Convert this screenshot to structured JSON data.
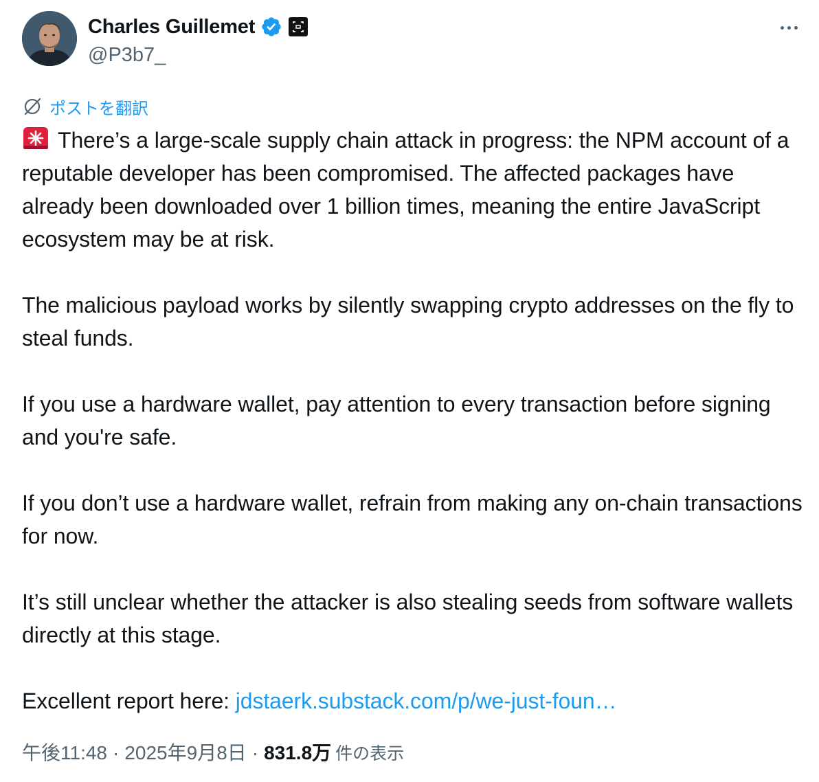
{
  "author": {
    "display_name": "Charles Guillemet",
    "handle": "@P3b7_",
    "icons": [
      "verified-badge-icon",
      "affiliate-badge-icon"
    ]
  },
  "actions": {
    "more": "more-options-icon"
  },
  "translate": {
    "label": "ポストを翻訳",
    "icon": "globe-translate-icon"
  },
  "tweet": {
    "p1": "There’s a large-scale supply chain attack in progress: the NPM account of a reputable developer has been compromised. The affected packages have already been downloaded over 1 billion times, meaning the entire JavaScript ecosystem may be at risk.",
    "p2": "The malicious payload works by silently swapping crypto addresses on the fly to steal funds.",
    "p3": "If you use a hardware wallet, pay attention to every transaction before signing and you're safe.",
    "p4": "If you don’t use a hardware wallet, refrain from making any on-chain transactions for now.",
    "p5": "It’s still unclear whether the attacker is also stealing seeds from software wallets directly at this stage.",
    "p6_prefix": "Excellent report here: ",
    "link": "jdstaerk.substack.com/p/we-just-foun…",
    "lead_icon": "siren-icon"
  },
  "meta": {
    "time": "午後11:48",
    "separator": "·",
    "date": "2025年9月8日",
    "views_count": "831.8万",
    "views_label": "件の表示"
  },
  "colors": {
    "link": "#1d9bf0",
    "text": "#0f1419",
    "secondary": "#536471"
  }
}
